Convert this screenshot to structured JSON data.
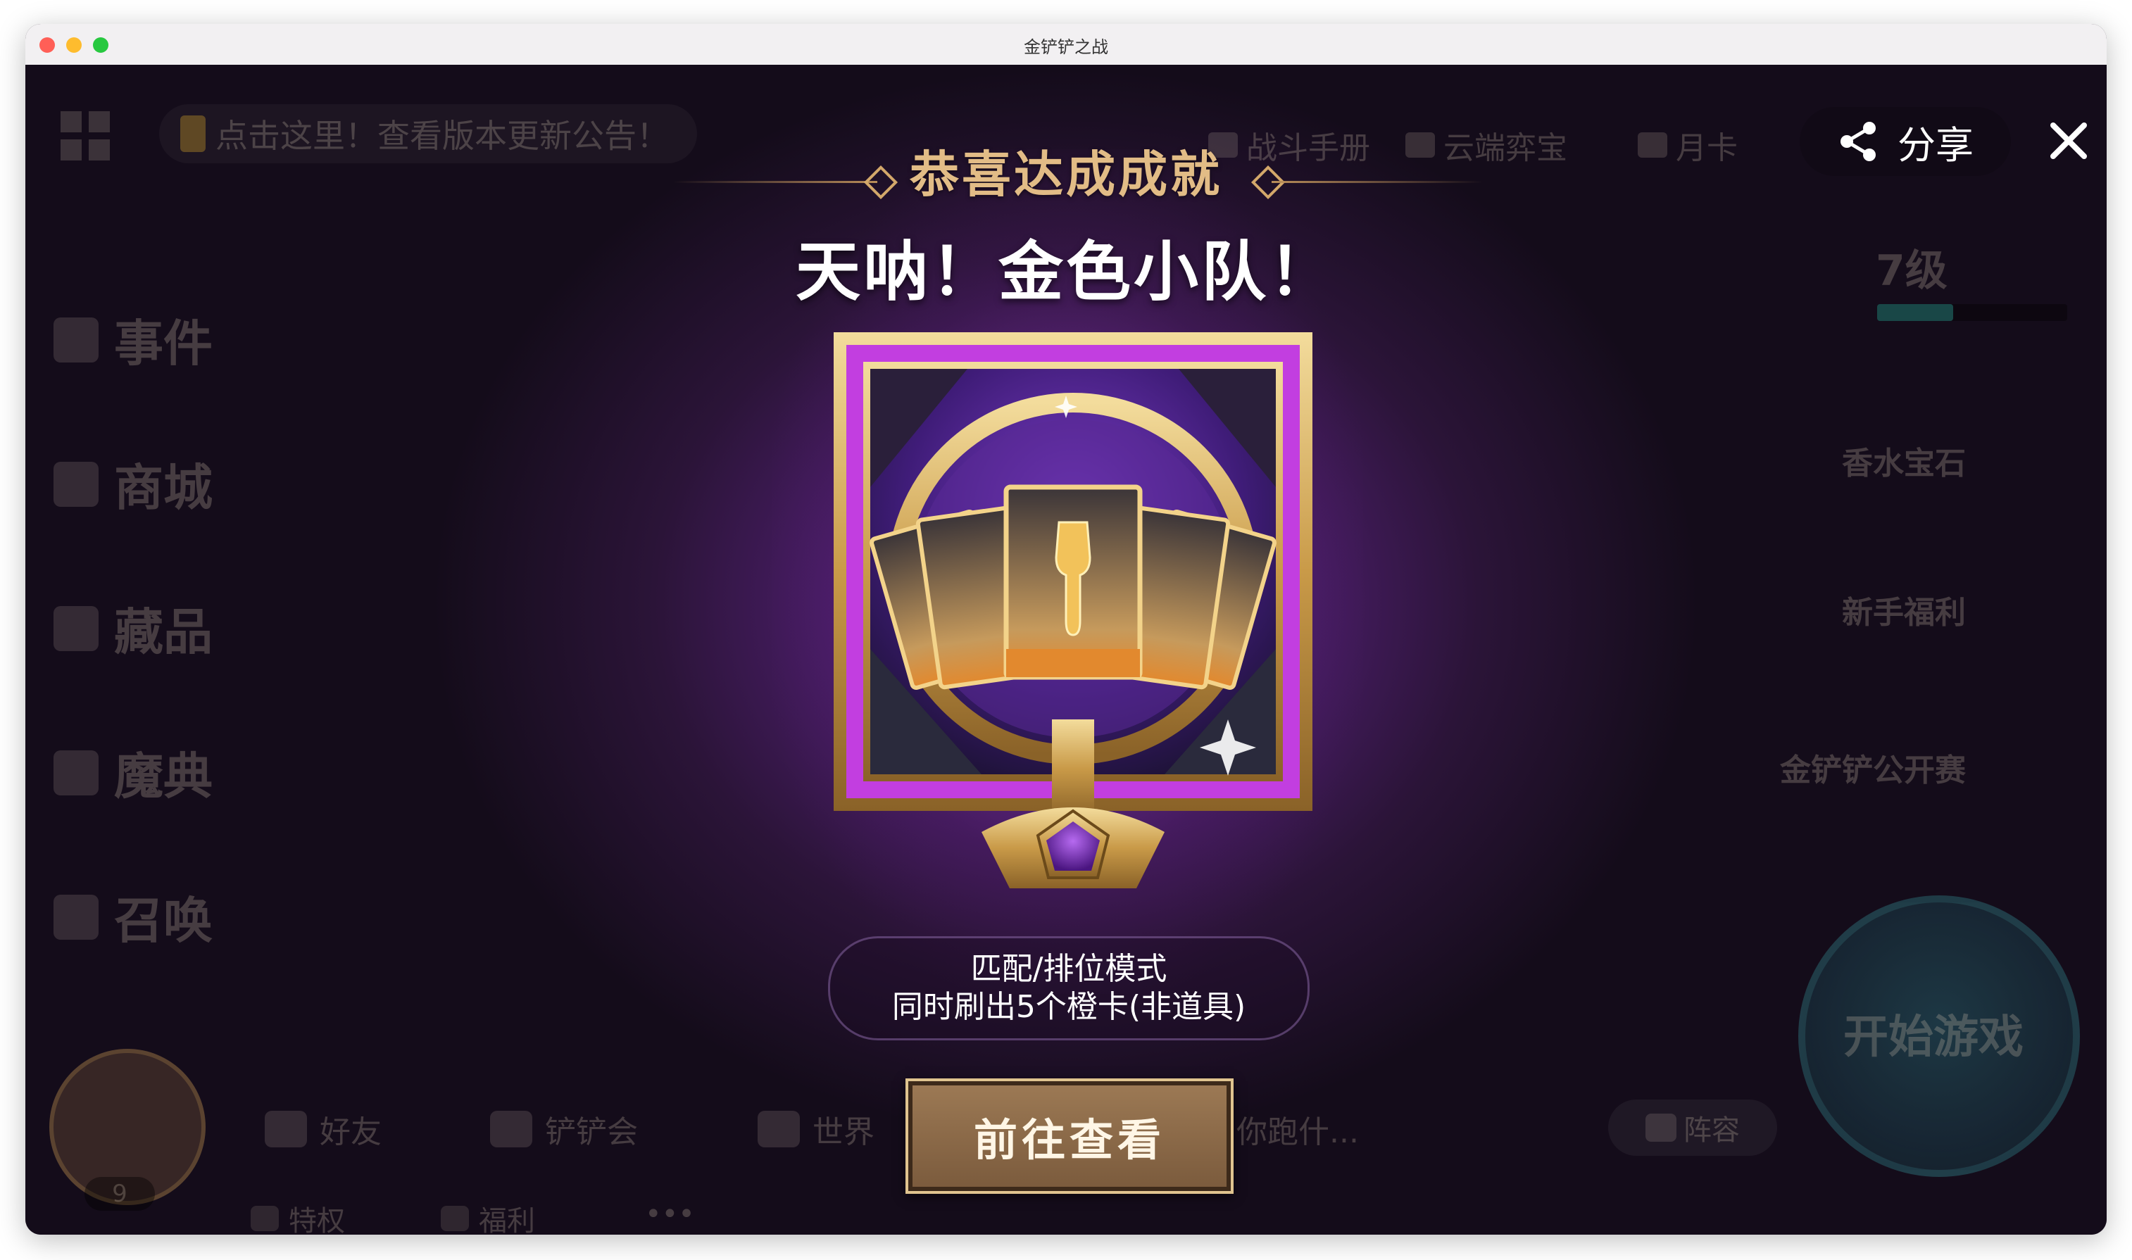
{
  "window": {
    "title": "金铲铲之战"
  },
  "background": {
    "notice": "点击这里！查看版本更新公告！",
    "top_nav": [
      "战斗手册",
      "云端弈宝",
      "月卡"
    ],
    "side_menu": [
      "事件",
      "商城",
      "藏品",
      "魔典",
      "召唤"
    ],
    "level": "7级",
    "level_progress": 0.4,
    "right_menu": [
      "香水宝石",
      "新手福利",
      "金铲铲公开赛"
    ],
    "start_game": "开始游戏",
    "bottom_nav": [
      "好友",
      "铲铲会",
      "世界",
      "你跑什..."
    ],
    "lineup": "阵容",
    "avatar_level": "9",
    "bottom_secondary": [
      "特权",
      "福利",
      "•••"
    ]
  },
  "modal": {
    "header": "恭喜达成成就",
    "achievement_title": "天呐！金色小队！",
    "description_line1": "匹配/排位模式",
    "description_line2": "同时刷出5个橙卡(非道具)",
    "go_button": "前往查看",
    "share_label": "分享"
  },
  "colors": {
    "header_gold": "#e2bc86",
    "frame_purple": "#c23ee0",
    "frame_gold": "#d6b36a",
    "card_orange": "#e2892e",
    "button_brown": "#8a6846"
  }
}
